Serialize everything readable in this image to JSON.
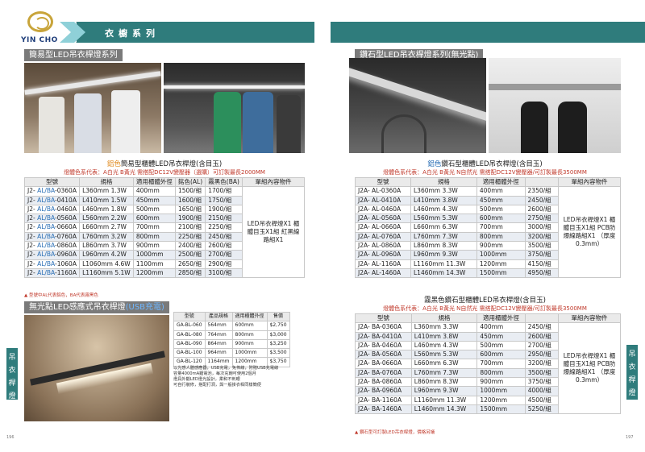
{
  "header": {
    "brand": "YIN CHO",
    "title": "衣櫥系列"
  },
  "left": {
    "sec1_title": "簡易型LED吊衣桿燈系列",
    "caption1_prefix": "鋁色",
    "caption1": "簡易型櫃體LED吊衣桿燈(含目玉)",
    "caption1_red": "燈體色系代表：A白光 B黃光 需搭配DC12V變壓器（選購）可訂製最長2000MM",
    "t1_headers": [
      "型號",
      "規格",
      "適用櫃體外徑",
      "銘色(AL)",
      "霧黑色(BA)",
      "單組內容物件"
    ],
    "t1_rows": [
      [
        "J2- AL/BA-0360A",
        "L360mm 1.3W",
        "400mm",
        "1500/組",
        "1700/組"
      ],
      [
        "J2- AL/BA-0410A",
        "L410mm 1.5W",
        "450mm",
        "1600/組",
        "1750/組"
      ],
      [
        "J2- AL/BA-0460A",
        "L460mm 1.8W",
        "500mm",
        "1650/組",
        "1900/組"
      ],
      [
        "J2- AL/BA-0560A",
        "L560mm 2.2W",
        "600mm",
        "1900/組",
        "2150/組"
      ],
      [
        "J2- AL/BA-0660A",
        "L660mm 2.7W",
        "700mm",
        "2100/組",
        "2250/組"
      ],
      [
        "J2- AL/BA-0760A",
        "L760mm 3.2W",
        "800mm",
        "2250/組",
        "2450/組"
      ],
      [
        "J2- AL/BA-0860A",
        "L860mm 3.7W",
        "900mm",
        "2400/組",
        "2600/組"
      ],
      [
        "J2- AL/BA-0960A",
        "L960mm 4.2W",
        "1000mm",
        "2500/組",
        "2700/組"
      ],
      [
        "J2- AL/BA-1060A",
        "L1060mm 4.6W",
        "1100mm",
        "2650/組",
        "2900/組"
      ],
      [
        "J2- AL/BA-1160A",
        "L1160mm 5.1W",
        "1200mm",
        "2850/組",
        "3100/組"
      ]
    ],
    "t1_contents": "LED吊衣桿燈X1 櫃體目玉X1組 紅黑線路組X1",
    "note1": "▲ 型號中AL代表鋁色，BA代表霧黑色",
    "sec2_title": "無光點LED感應式吊衣桿燈",
    "sec2_badge": "(USB充電)",
    "t2_headers": [
      "型號",
      "產品規格",
      "適用櫃體外徑",
      "售價"
    ],
    "t2_rows": [
      [
        "GA-BL-060",
        "564mm",
        "600mm",
        "$2,750"
      ],
      [
        "GA-BL-080",
        "764mm",
        "800mm",
        "$3,000"
      ],
      [
        "GA-BL-090",
        "864mm",
        "900mm",
        "$3,250"
      ],
      [
        "GA-BL-100",
        "964mm",
        "1000mm",
        "$3,500"
      ],
      [
        "GA-BL-120",
        "1164mm",
        "1200mm",
        "$3,750"
      ]
    ],
    "t2_notes": [
      "以光感人體感應器，USB充電，免佈線，附贈USB充電線",
      "容量4000mA鋰電池，每次充飽可使用2個月",
      "燈具外觀LED燈光設計，柔和不刺眼",
      "可自行裝修，搭配打洞，與一般掛衣桿同樣簡便"
    ],
    "side_tab": "吊衣桿燈",
    "page_no": "196"
  },
  "right": {
    "sec_title": "鑽石型LED吊衣桿燈系列(無光點)",
    "caption_a_prefix": "鋁色",
    "caption_a": "鑽石型櫃體LED吊衣桿燈(含目玉)",
    "caption_a_red": "燈體色系代表：A白光 B黃光 N自然光 需搭配DC12V變壓器/可訂製最長3500MM",
    "ta_headers": [
      "型號",
      "規格",
      "適用櫃體外徑",
      "",
      "單組內容物件"
    ],
    "ta_rows": [
      [
        "J2A- AL-0360A",
        "L360mm 3.3W",
        "400mm",
        "2350/組"
      ],
      [
        "J2A- AL-0410A",
        "L410mm 3.8W",
        "450mm",
        "2450/組"
      ],
      [
        "J2A- AL-0460A",
        "L460mm 4.3W",
        "500mm",
        "2600/組"
      ],
      [
        "J2A- AL-0560A",
        "L560mm 5.3W",
        "600mm",
        "2750/組"
      ],
      [
        "J2A- AL-0660A",
        "L660mm 6.3W",
        "700mm",
        "3000/組"
      ],
      [
        "J2A- AL-0760A",
        "L760mm 7.3W",
        "800mm",
        "3200/組"
      ],
      [
        "J2A- AL-0860A",
        "L860mm 8.3W",
        "900mm",
        "3500/組"
      ],
      [
        "J2A- AL-0960A",
        "L960mm 9.3W",
        "1000mm",
        "3750/組"
      ],
      [
        "J2A- AL-1160A",
        "L1160mm 11.3W",
        "1200mm",
        "4150/組"
      ],
      [
        "J2A- AL-1460A",
        "L1460mm 14.3W",
        "1500mm",
        "4950/組"
      ]
    ],
    "ta_contents": "LED吊衣桿燈X1 櫃體目玉X1組 PCB防爆線路組X1 （厚度0.3mm）",
    "caption_b": "霧黑色鑽石型櫃體LED吊衣桿燈(含目玉)",
    "caption_b_red": "燈體色系代表：A白光 B黃光 N自然光 需搭配DC12V變壓器/可訂製最長3500MM",
    "tb_headers": [
      "型號",
      "規格",
      "適用櫃體外徑",
      "",
      "單組內容物件"
    ],
    "tb_rows": [
      [
        "J2A- BA-0360A",
        "L360mm 3.3W",
        "400mm",
        "2450/組"
      ],
      [
        "J2A- BA-0410A",
        "L410mm 3.8W",
        "450mm",
        "2600/組"
      ],
      [
        "J2A- BA-0460A",
        "L460mm 4.3W",
        "500mm",
        "2700/組"
      ],
      [
        "J2A- BA-0560A",
        "L560mm 5.3W",
        "600mm",
        "2950/組"
      ],
      [
        "J2A- BA-0660A",
        "L660mm 6.3W",
        "700mm",
        "3200/組"
      ],
      [
        "J2A- BA-0760A",
        "L760mm 7.3W",
        "800mm",
        "3500/組"
      ],
      [
        "J2A- BA-0860A",
        "L860mm 8.3W",
        "900mm",
        "3750/組"
      ],
      [
        "J2A- BA-0960A",
        "L960mm 9.3W",
        "1000mm",
        "4000/組"
      ],
      [
        "J2A- BA-1160A",
        "L1160mm 11.3W",
        "1200mm",
        "4500/組"
      ],
      [
        "J2A- BA-1460A",
        "L1460mm 14.3W",
        "1500mm",
        "5250/組"
      ]
    ],
    "tb_contents": "LED吊衣桿燈X1 櫃體目玉X1組 PCB防爆線路組X1 （厚度0.3mm）",
    "note": "▲ 鑽石型可訂製LED吊衣桿燈，價格另議",
    "side_tab": "吊衣桿燈",
    "page_no": "197"
  },
  "colors": {
    "band": "#2f7c7c",
    "brand": "#c8a43a",
    "accent_text": "#c0392b",
    "orange": "#e08a1e",
    "blue": "#2a6fb5"
  }
}
